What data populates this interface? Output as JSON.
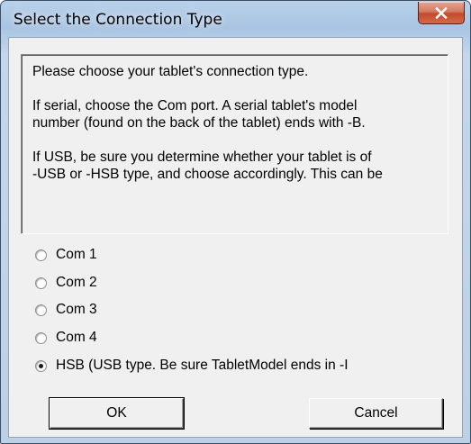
{
  "window": {
    "title": "Select the Connection Type"
  },
  "message": {
    "line1": "Please choose your tablet's connection type.",
    "line2": "If serial, choose the Com port. A serial tablet's model",
    "line3": "number (found on the back of the tablet) ends with -B.",
    "line4": "If USB, be sure you determine whether your tablet is of",
    "line5": "-USB or -HSB type, and choose accordingly. This can be"
  },
  "options": [
    {
      "label": "Com 1",
      "selected": false
    },
    {
      "label": "Com 2",
      "selected": false
    },
    {
      "label": "Com 3",
      "selected": false
    },
    {
      "label": "Com 4",
      "selected": false
    },
    {
      "label": "HSB (USB type. Be sure TabletModel ends in -I",
      "selected": true
    }
  ],
  "buttons": {
    "ok_label": "OK",
    "cancel_label": "Cancel"
  },
  "icons": {
    "close": "close-icon",
    "radio": "radio-button"
  },
  "colors": {
    "title_bar": "#b9d1ea",
    "close_button": "#c9543a",
    "dialog_background": "#f0f0f0"
  }
}
